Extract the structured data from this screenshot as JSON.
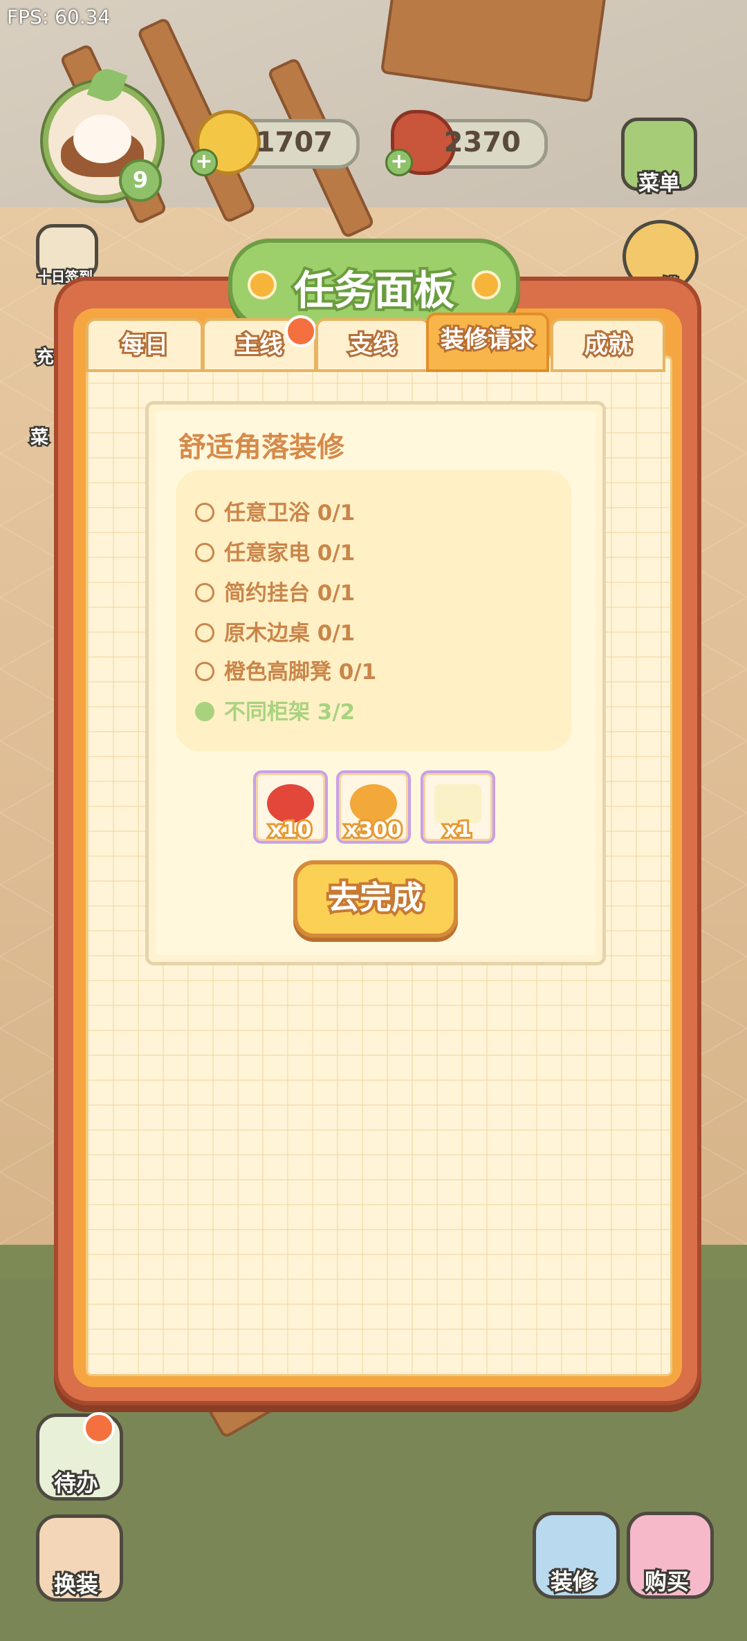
{
  "hud": {
    "fps": "FPS: 60.34",
    "player_level": "9",
    "coins": "1707",
    "food": "2370"
  },
  "side_buttons": {
    "menu": "菜单",
    "checkin_partial": "十日签到",
    "right_partial": "罐",
    "left_partial_1": "充",
    "left_partial_2": "菜"
  },
  "panel": {
    "title": "任务面板",
    "tabs": [
      {
        "label": "每日",
        "active": false
      },
      {
        "label": "主线",
        "active": false,
        "badge": true
      },
      {
        "label": "支线",
        "active": false
      },
      {
        "label": "装修请求",
        "active": true
      },
      {
        "label": "成就",
        "active": false
      }
    ],
    "task": {
      "title": "舒适角落装修",
      "requirements": [
        {
          "text": "任意卫浴 0/1",
          "done": false
        },
        {
          "text": "任意家电 0/1",
          "done": false
        },
        {
          "text": "简约挂台 0/1",
          "done": false
        },
        {
          "text": "原木边桌 0/1",
          "done": false
        },
        {
          "text": "橙色高脚凳 0/1",
          "done": false
        },
        {
          "text": "不同柜架 3/2",
          "done": true
        }
      ],
      "rewards": [
        {
          "icon": "cherry-icon",
          "qty": "x10"
        },
        {
          "icon": "gold-nugget-icon",
          "qty": "x300"
        },
        {
          "icon": "sprout-box-icon",
          "qty": "x1"
        }
      ],
      "action_label": "去完成"
    }
  },
  "bottom_buttons": {
    "todo": "待办",
    "dress": "换装",
    "decorate": "装修",
    "shop": "购买"
  },
  "colors": {
    "panel_border": "#d9704a",
    "tab_active": "#f8b64a",
    "title_banner": "#9dcf6a",
    "done_green": "#a9d27f",
    "text_brown": "#c9854a"
  }
}
